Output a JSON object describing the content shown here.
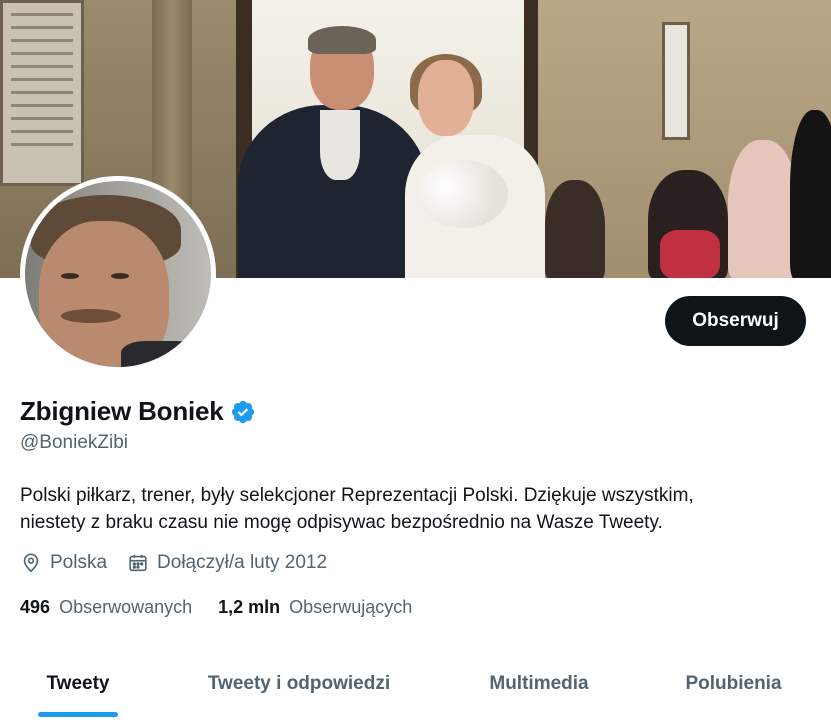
{
  "profile": {
    "name": "Zbigniew Boniek",
    "handle": "@BoniekZibi",
    "bio_line1": "Polski piłkarz, trener, były selekcjoner Reprezentacji Polski. Dziękuje wszystkim,",
    "bio_line2": "niestety z braku czasu nie mogę odpisywac bezpośrednio na Wasze Tweety.",
    "location": "Polska",
    "joined": "Dołączył/a luty 2012",
    "verified": true
  },
  "actions": {
    "follow_label": "Obserwuj"
  },
  "stats": {
    "following_count": "496",
    "following_label": "Obserwowanych",
    "followers_count": "1,2 mln",
    "followers_label": "Obserwujących"
  },
  "tabs": [
    {
      "label": "Tweety",
      "active": true
    },
    {
      "label": "Tweety i odpowiedzi",
      "active": false
    },
    {
      "label": "Multimedia",
      "active": false
    },
    {
      "label": "Polubienia",
      "active": false
    }
  ],
  "icons": {
    "verified": "verified-badge-icon",
    "location": "location-pin-icon",
    "calendar": "calendar-icon"
  },
  "colors": {
    "accent": "#1d9bf0",
    "text_primary": "#0f1419",
    "text_secondary": "#536471",
    "button_bg": "#0f1419"
  }
}
